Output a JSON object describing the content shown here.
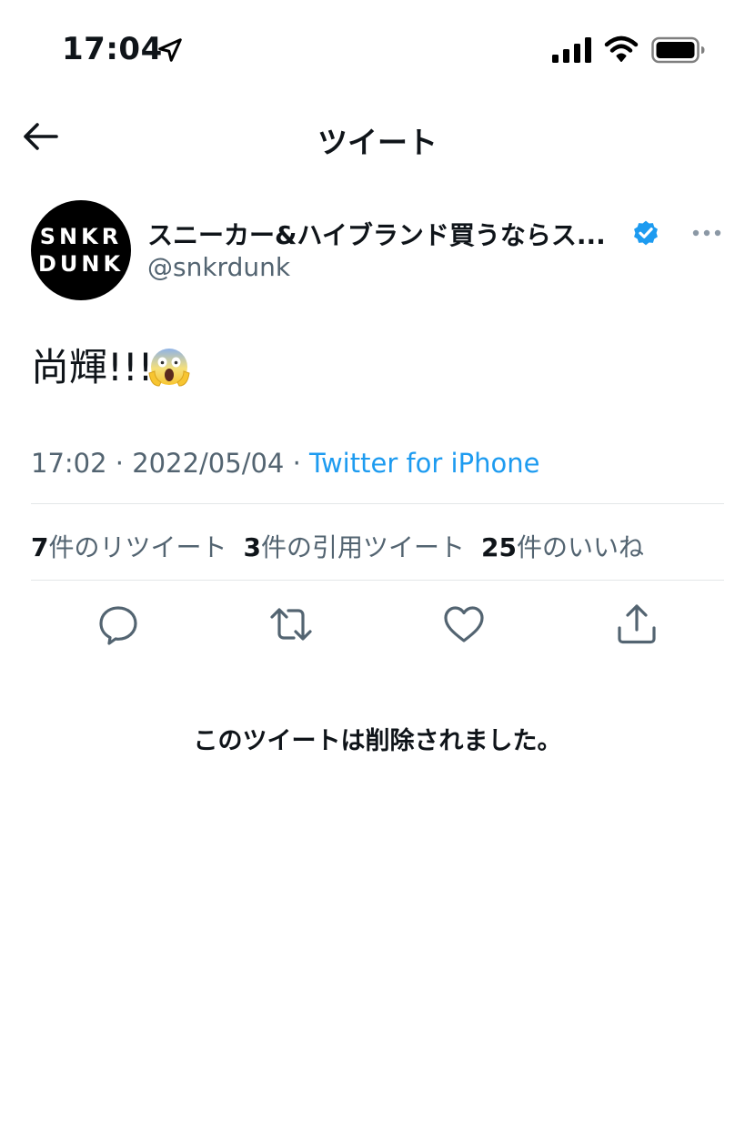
{
  "status_bar": {
    "time": "17:04",
    "location_icon": "location-arrow-icon",
    "signal_icon": "cellular-signal-icon",
    "wifi_icon": "wifi-icon",
    "battery_icon": "battery-icon"
  },
  "header": {
    "title": "ツイート",
    "back_icon": "arrow-left-icon"
  },
  "tweet": {
    "avatar_text_line1": "SNKR",
    "avatar_text_line2": "DUNK",
    "display_name": "スニーカー&ハイブランド買うならス...",
    "handle": "@snkrdunk",
    "verified_icon": "verified-badge-icon",
    "verified_color": "#1d9bf0",
    "more_icon": "more-dots-icon",
    "text": "尚輝!!!",
    "emoji_icon": "face-screaming-in-fear-icon",
    "time": "17:02",
    "date": "2022/05/04",
    "separator": "·",
    "source": "Twitter for iPhone",
    "source_color": "#1d9bf0"
  },
  "stats": {
    "retweets_count": "7",
    "retweets_label": "件のリツイート",
    "quotes_count": "3",
    "quotes_label": "件の引用ツイート",
    "likes_count": "25",
    "likes_label": "件のいいね"
  },
  "actions": {
    "reply_icon": "reply-icon",
    "retweet_icon": "retweet-icon",
    "like_icon": "heart-icon",
    "share_icon": "share-icon"
  },
  "notice": "このツイートは削除されました。"
}
